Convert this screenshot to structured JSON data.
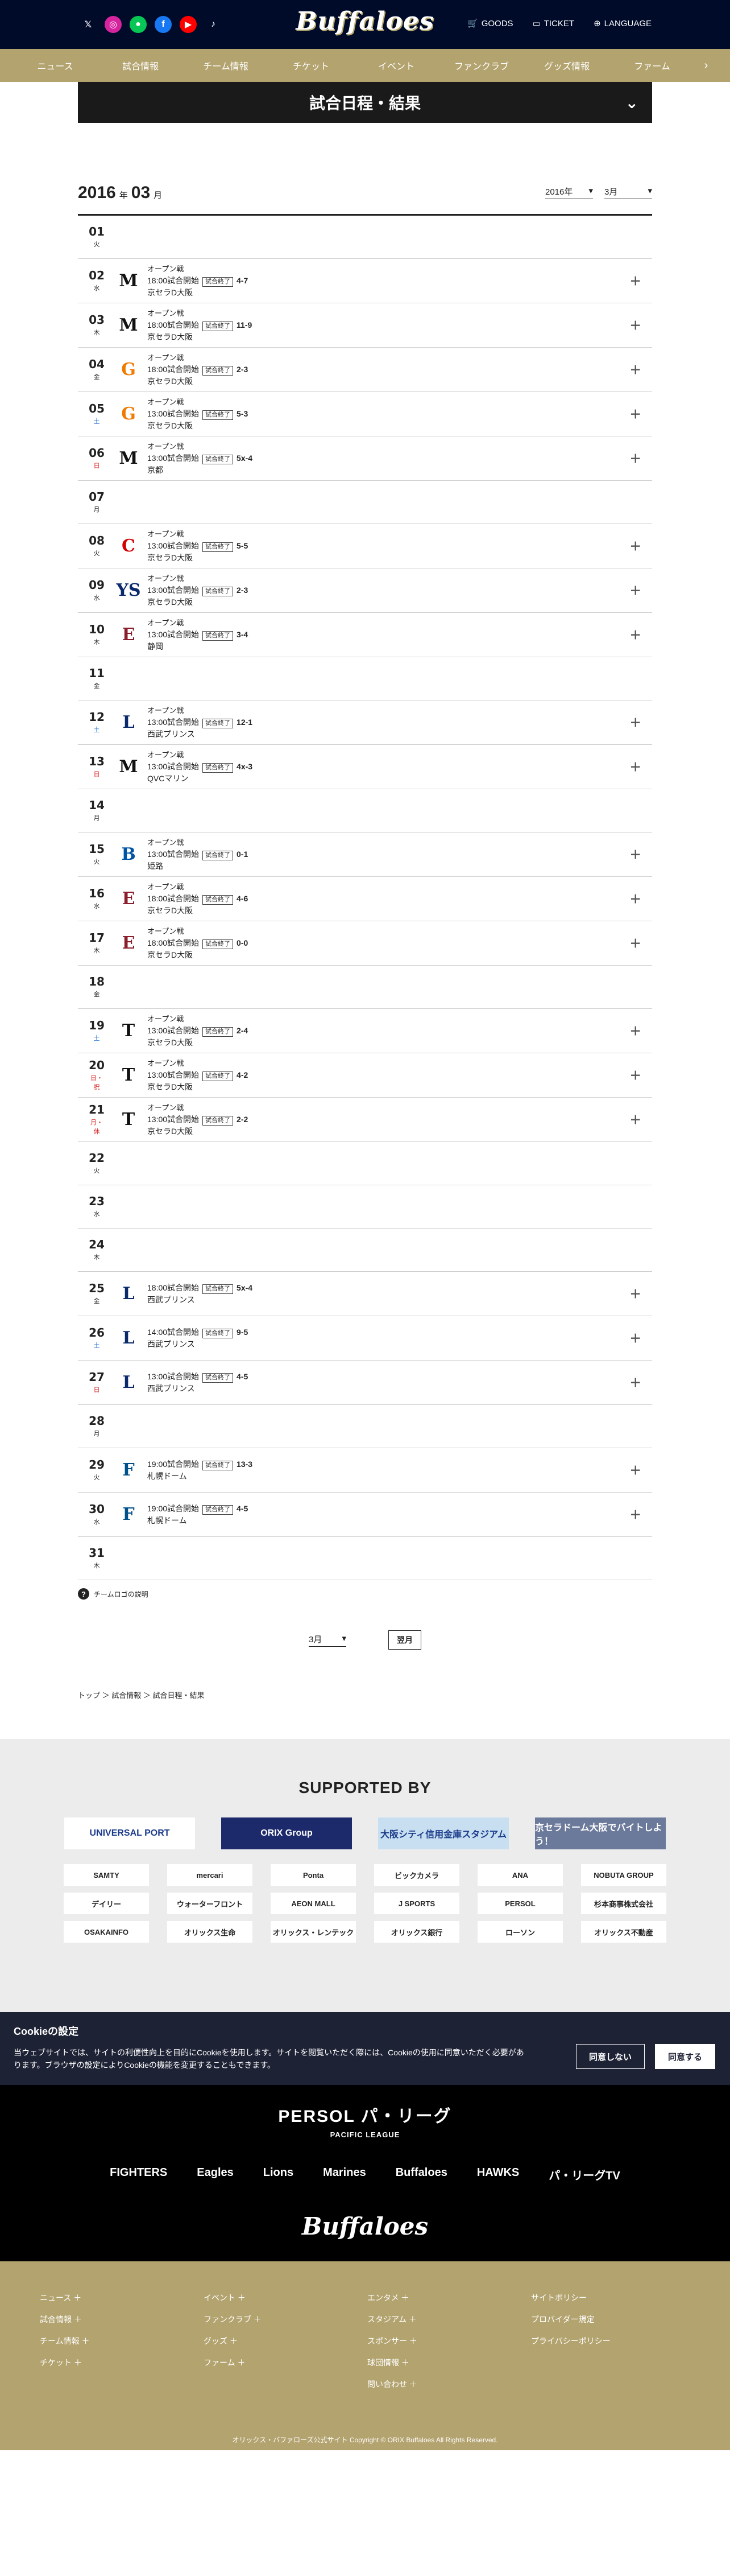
{
  "header": {
    "logo": "Buffaloes",
    "social": [
      {
        "icon": "x-icon",
        "glyph": "𝕏",
        "color": "#000b2a"
      },
      {
        "icon": "instagram-icon",
        "glyph": "◎",
        "color": "#d6249f"
      },
      {
        "icon": "line-icon",
        "glyph": "●",
        "color": "#06c755"
      },
      {
        "icon": "facebook-icon",
        "glyph": "f",
        "color": "#1877f2"
      },
      {
        "icon": "youtube-icon",
        "glyph": "▶",
        "color": "#ff0000"
      },
      {
        "icon": "tiktok-icon",
        "glyph": "♪",
        "color": "#000b2a"
      }
    ],
    "goods": "GOODS",
    "ticket": "TICKET",
    "language": "LANGUAGE"
  },
  "nav": [
    "ニュース",
    "試合情報",
    "チーム情報",
    "チケット",
    "イベント",
    "ファンクラブ",
    "グッズ情報",
    "ファーム"
  ],
  "page_title": "試合日程・結果",
  "year": "2016",
  "year_unit": "年",
  "month": "03",
  "month_unit": "月",
  "year_select": "2016年",
  "month_select": "3月",
  "schedule": [
    {
      "d": "01",
      "w": "火"
    },
    {
      "d": "02",
      "w": "水",
      "team": "M",
      "tc": "#111",
      "type": "オープン戦",
      "time": "18:00試合開始",
      "badge": "試合終了",
      "score": "4-7",
      "venue": "京セラD大阪"
    },
    {
      "d": "03",
      "w": "木",
      "team": "M",
      "tc": "#111",
      "type": "オープン戦",
      "time": "18:00試合開始",
      "badge": "試合終了",
      "score": "11-9",
      "venue": "京セラD大阪"
    },
    {
      "d": "04",
      "w": "金",
      "team": "G",
      "tc": "#f07a00",
      "type": "オープン戦",
      "time": "18:00試合開始",
      "badge": "試合終了",
      "score": "2-3",
      "venue": "京セラD大阪"
    },
    {
      "d": "05",
      "w": "土",
      "ws": "sat",
      "team": "G",
      "tc": "#f07a00",
      "type": "オープン戦",
      "time": "13:00試合開始",
      "badge": "試合終了",
      "score": "5-3",
      "venue": "京セラD大阪"
    },
    {
      "d": "06",
      "w": "日",
      "ws": "sun",
      "team": "M",
      "tc": "#111",
      "type": "オープン戦",
      "time": "13:00試合開始",
      "badge": "試合終了",
      "score": "5x-4",
      "venue": "京都"
    },
    {
      "d": "07",
      "w": "月"
    },
    {
      "d": "08",
      "w": "火",
      "team": "C",
      "tc": "#d40000",
      "type": "オープン戦",
      "time": "13:00試合開始",
      "badge": "試合終了",
      "score": "5-5",
      "venue": "京セラD大阪"
    },
    {
      "d": "09",
      "w": "水",
      "team": "YS",
      "tc": "#0a2a6b",
      "type": "オープン戦",
      "time": "13:00試合開始",
      "badge": "試合終了",
      "score": "2-3",
      "venue": "京セラD大阪"
    },
    {
      "d": "10",
      "w": "木",
      "team": "E",
      "tc": "#8b1d2c",
      "type": "オープン戦",
      "time": "13:00試合開始",
      "badge": "試合終了",
      "score": "3-4",
      "venue": "静岡"
    },
    {
      "d": "11",
      "w": "金"
    },
    {
      "d": "12",
      "w": "土",
      "ws": "sat",
      "team": "L",
      "tc": "#0a2a6b",
      "type": "オープン戦",
      "time": "13:00試合開始",
      "badge": "試合終了",
      "score": "12-1",
      "venue": "西武プリンス"
    },
    {
      "d": "13",
      "w": "日",
      "ws": "sun",
      "team": "M",
      "tc": "#111",
      "type": "オープン戦",
      "time": "13:00試合開始",
      "badge": "試合終了",
      "score": "4x-3",
      "venue": "QVCマリン"
    },
    {
      "d": "14",
      "w": "月"
    },
    {
      "d": "15",
      "w": "火",
      "team": "B",
      "tc": "#0054a6",
      "type": "オープン戦",
      "time": "13:00試合開始",
      "badge": "試合終了",
      "score": "0-1",
      "venue": "姫路"
    },
    {
      "d": "16",
      "w": "水",
      "team": "E",
      "tc": "#8b1d2c",
      "type": "オープン戦",
      "time": "18:00試合開始",
      "badge": "試合終了",
      "score": "4-6",
      "venue": "京セラD大阪"
    },
    {
      "d": "17",
      "w": "木",
      "team": "E",
      "tc": "#8b1d2c",
      "type": "オープン戦",
      "time": "18:00試合開始",
      "badge": "試合終了",
      "score": "0-0",
      "venue": "京セラD大阪"
    },
    {
      "d": "18",
      "w": "金"
    },
    {
      "d": "19",
      "w": "土",
      "ws": "sat",
      "team": "T",
      "tc": "#111",
      "type": "オープン戦",
      "time": "13:00試合開始",
      "badge": "試合終了",
      "score": "2-4",
      "venue": "京セラD大阪"
    },
    {
      "d": "20",
      "w": "日・祝",
      "ws": "sun",
      "team": "T",
      "tc": "#111",
      "type": "オープン戦",
      "time": "13:00試合開始",
      "badge": "試合終了",
      "score": "4-2",
      "venue": "京セラD大阪"
    },
    {
      "d": "21",
      "w": "月・休",
      "ws": "sun",
      "team": "T",
      "tc": "#111",
      "type": "オープン戦",
      "time": "13:00試合開始",
      "badge": "試合終了",
      "score": "2-2",
      "venue": "京セラD大阪"
    },
    {
      "d": "22",
      "w": "火"
    },
    {
      "d": "23",
      "w": "水"
    },
    {
      "d": "24",
      "w": "木"
    },
    {
      "d": "25",
      "w": "金",
      "team": "L",
      "tc": "#0a2a6b",
      "time": "18:00試合開始",
      "badge": "試合終了",
      "score": "5x-4",
      "venue": "西武プリンス"
    },
    {
      "d": "26",
      "w": "土",
      "ws": "sat",
      "team": "L",
      "tc": "#0a2a6b",
      "time": "14:00試合開始",
      "badge": "試合終了",
      "score": "9-5",
      "venue": "西武プリンス"
    },
    {
      "d": "27",
      "w": "日",
      "ws": "sun",
      "team": "L",
      "tc": "#0a2a6b",
      "time": "13:00試合開始",
      "badge": "試合終了",
      "score": "4-5",
      "venue": "西武プリンス"
    },
    {
      "d": "28",
      "w": "月"
    },
    {
      "d": "29",
      "w": "火",
      "team": "F",
      "tc": "#00508c",
      "time": "19:00試合開始",
      "badge": "試合終了",
      "score": "13-3",
      "venue": "札幌ドーム"
    },
    {
      "d": "30",
      "w": "水",
      "team": "F",
      "tc": "#00508c",
      "time": "19:00試合開始",
      "badge": "試合終了",
      "score": "4-5",
      "venue": "札幌ドーム"
    },
    {
      "d": "31",
      "w": "木"
    }
  ],
  "legend": "チームロゴの説明",
  "pager_month": "3月",
  "next_month": "翌月",
  "breadcrumb": "トップ ＞ 試合情報 ＞ 試合日程・結果",
  "supported_by": "SUPPORTED BY",
  "sponsors_main": [
    {
      "name": "UNIVERSAL PORT",
      "bg": "#ffffff",
      "fg": "#1b3b8a"
    },
    {
      "name": "ORIX Group",
      "bg": "#1c2a6b",
      "fg": "#ffffff"
    },
    {
      "name": "大阪シティ信用金庫スタジアム",
      "bg": "#c8dff2",
      "fg": "#1b3b8a"
    },
    {
      "name": "京セラドーム大阪でバイトしよう！",
      "bg": "#6b7a9a",
      "fg": "#ffffff"
    }
  ],
  "sponsors": [
    "SAMTY",
    "mercari",
    "Ponta",
    "ビックカメラ",
    "ANA",
    "NOBUTA GROUP",
    "デイリー",
    "ウォーターフロント",
    "AEON MALL",
    "J SPORTS",
    "PERSOL",
    "杉本商事株式会社",
    "OSAKAINFO",
    "オリックス生命",
    "オリックス・レンテック",
    "オリックス銀行",
    "ローソン",
    "オリックス不動産"
  ],
  "cookie": {
    "title": "Cookieの設定",
    "text": "当ウェブサイトでは、サイトの利便性向上を目的にCookieを使用します。サイトを閲覧いただく際には、Cookieの使用に同意いただく必要があります。ブラウザの設定によりCookieの機能を変更することもできます。",
    "deny": "同意しない",
    "accept": "同意する"
  },
  "league": {
    "title": "PERSOL パ・リーグ",
    "sub": "PACIFIC LEAGUE"
  },
  "league_teams": [
    "FIGHTERS",
    "Eagles",
    "Lions",
    "Marines",
    "Buffaloes",
    "HAWKS",
    "パ・リーグTV"
  ],
  "footer_logo": "Buffaloes",
  "footer_cols": [
    [
      "ニュース ＋",
      "試合情報 ＋",
      "チーム情報 ＋",
      "チケット ＋"
    ],
    [
      "イベント ＋",
      "ファンクラブ ＋",
      "グッズ ＋",
      "ファーム ＋"
    ],
    [
      "エンタメ ＋",
      "スタジアム ＋",
      "スポンサー ＋",
      "球団情報 ＋",
      "問い合わせ ＋"
    ],
    [
      "サイトポリシー",
      "プロバイダー規定",
      "プライバシーポリシー"
    ]
  ],
  "copyright": "オリックス・バファローズ公式サイト Copyright © ORIX Buffaloes All Rights Reserved."
}
